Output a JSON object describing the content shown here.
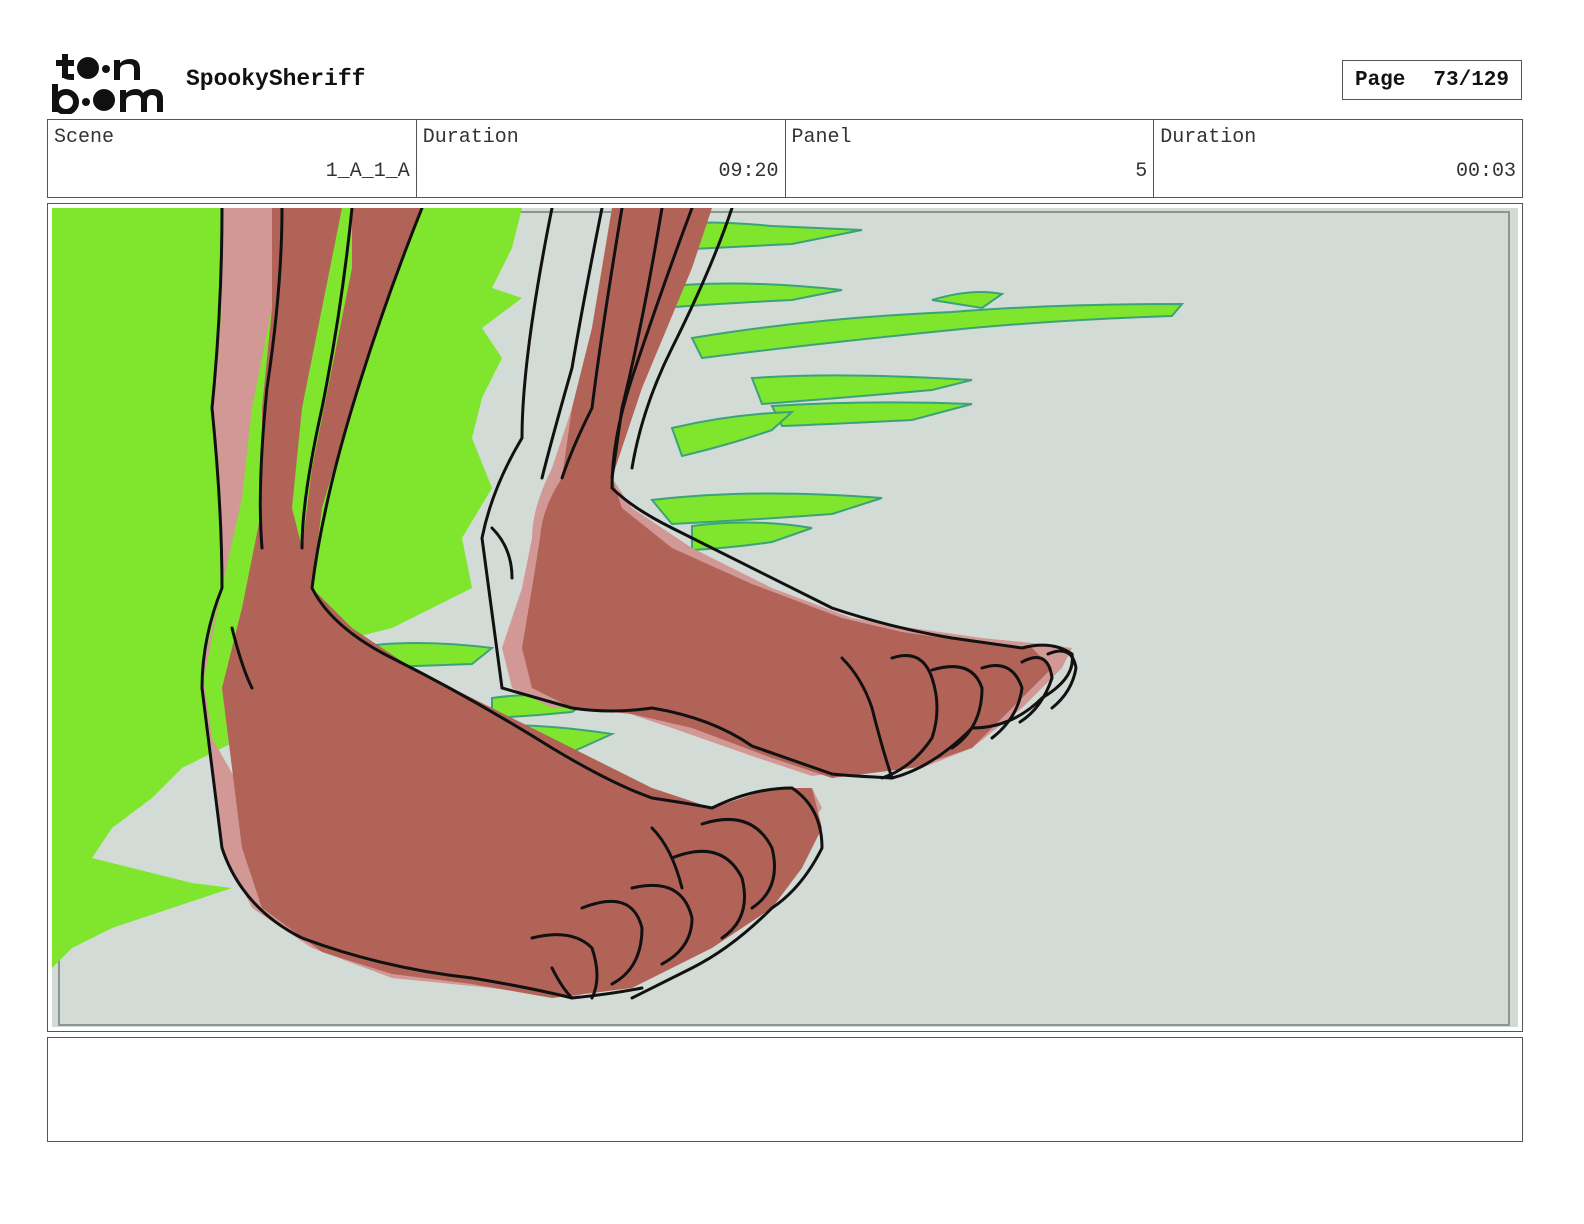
{
  "header": {
    "project_title": "SpookySheriff",
    "logo_text": "toon boom",
    "page_label": "Page",
    "page_value": "73/129"
  },
  "info": {
    "scene_label": "Scene",
    "scene_value": "1_A_1_A",
    "scene_duration_label": "Duration",
    "scene_duration_value": "09:20",
    "panel_label": "Panel",
    "panel_value": "5",
    "panel_duration_label": "Duration",
    "panel_duration_value": "00:03"
  },
  "notes": {
    "text": ""
  },
  "colors": {
    "background": "#d2dbd5",
    "green": "#7fe52d",
    "skin": "#b26358",
    "skin_light": "#d29896",
    "outline": "#111111",
    "frame": "#555555"
  }
}
